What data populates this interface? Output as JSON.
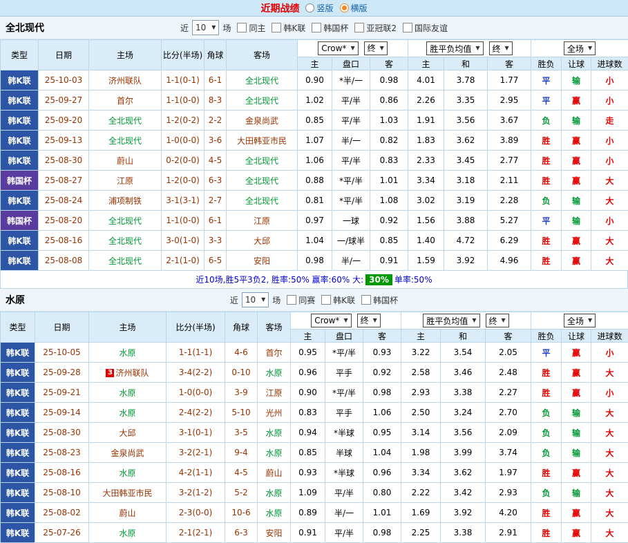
{
  "page": {
    "title": "近期战绩",
    "layout_options": [
      {
        "label": "竖版",
        "selected": false
      },
      {
        "label": "横版",
        "selected": true
      }
    ]
  },
  "colors": {
    "title_red": "#e60000",
    "team_regular": "#993300",
    "team_focus": "#009933",
    "summary_text": "#0000d0",
    "summary_highlight_bg": "#009900",
    "header_bg": "#d9ecf8",
    "topbar_bg": "#cde9f8"
  },
  "type_colors": {
    "韩K联": "#2c55a5",
    "韩国杯": "#5a3b9e"
  },
  "result_colors": {
    "胜": "#e60000",
    "平": "#1e3cc8",
    "负": "#009933",
    "赢": "#e60000",
    "输": "#009933",
    "走": "#e60000",
    "大": "#e60000",
    "小": "#e60000"
  },
  "sections": [
    {
      "team": "全北现代",
      "filter": {
        "prefix": "近",
        "count": "10",
        "suffix": "场",
        "checkboxes": [
          "同主",
          "韩K联",
          "韩国杯",
          "亚冠联2",
          "国际友谊"
        ]
      },
      "header": {
        "type": "类型",
        "date": "日期",
        "home": "主场",
        "score": "比分(半场)",
        "corner": "角球",
        "away": "客场",
        "selects": [
          "Crow*",
          "终",
          "胜平负均值",
          "终",
          "全场"
        ],
        "sub": [
          "主",
          "盘口",
          "客",
          "主",
          "和",
          "客",
          "胜负",
          "让球",
          "进球数"
        ]
      },
      "rows": [
        {
          "type": "韩K联",
          "date": "25-10-03",
          "home": "济州联队",
          "home_focus": false,
          "score": "1-1(0-1)",
          "corner": "6-1",
          "away": "全北现代",
          "away_focus": true,
          "h1": "0.90",
          "handicap": "*半/一",
          "a1": "0.98",
          "h2": "4.01",
          "d2": "3.78",
          "a2": "1.77",
          "result": "平",
          "bet_result": "输",
          "goals": "小"
        },
        {
          "type": "韩K联",
          "date": "25-09-27",
          "home": "首尔",
          "home_focus": false,
          "score": "1-1(0-0)",
          "corner": "8-3",
          "away": "全北现代",
          "away_focus": true,
          "h1": "1.02",
          "handicap": "平/半",
          "a1": "0.86",
          "h2": "2.26",
          "d2": "3.35",
          "a2": "2.95",
          "result": "平",
          "bet_result": "赢",
          "goals": "小"
        },
        {
          "type": "韩K联",
          "date": "25-09-20",
          "home": "全北现代",
          "home_focus": true,
          "score": "1-2(0-2)",
          "corner": "2-2",
          "away": "金泉尚武",
          "away_focus": false,
          "h1": "0.85",
          "handicap": "平/半",
          "a1": "1.03",
          "h2": "1.91",
          "d2": "3.56",
          "a2": "3.67",
          "result": "负",
          "bet_result": "输",
          "goals": "走"
        },
        {
          "type": "韩K联",
          "date": "25-09-13",
          "home": "全北现代",
          "home_focus": true,
          "score": "1-0(0-0)",
          "corner": "3-6",
          "away": "大田韩亚市民",
          "away_focus": false,
          "h1": "1.07",
          "handicap": "半/一",
          "a1": "0.82",
          "h2": "1.83",
          "d2": "3.62",
          "a2": "3.89",
          "result": "胜",
          "bet_result": "赢",
          "goals": "小"
        },
        {
          "type": "韩K联",
          "date": "25-08-30",
          "home": "蔚山",
          "home_focus": false,
          "score": "0-2(0-0)",
          "corner": "4-5",
          "away": "全北现代",
          "away_focus": true,
          "h1": "1.06",
          "handicap": "平/半",
          "a1": "0.83",
          "h2": "2.33",
          "d2": "3.45",
          "a2": "2.77",
          "result": "胜",
          "bet_result": "赢",
          "goals": "小"
        },
        {
          "type": "韩国杯",
          "date": "25-08-27",
          "home": "江原",
          "home_focus": false,
          "score": "1-2(0-0)",
          "corner": "6-3",
          "away": "全北现代",
          "away_focus": true,
          "h1": "0.88",
          "handicap": "*平/半",
          "a1": "1.01",
          "h2": "3.34",
          "d2": "3.18",
          "a2": "2.11",
          "result": "胜",
          "bet_result": "赢",
          "goals": "大"
        },
        {
          "type": "韩K联",
          "date": "25-08-24",
          "home": "浦项制铁",
          "home_focus": false,
          "score": "3-1(3-1)",
          "corner": "2-7",
          "away": "全北现代",
          "away_focus": true,
          "h1": "0.81",
          "handicap": "*平/半",
          "a1": "1.08",
          "h2": "3.02",
          "d2": "3.19",
          "a2": "2.28",
          "result": "负",
          "bet_result": "输",
          "goals": "大"
        },
        {
          "type": "韩国杯",
          "date": "25-08-20",
          "home": "全北现代",
          "home_focus": true,
          "score": "1-1(0-0)",
          "corner": "6-1",
          "away": "江原",
          "away_focus": false,
          "h1": "0.97",
          "handicap": "一球",
          "a1": "0.92",
          "h2": "1.56",
          "d2": "3.88",
          "a2": "5.27",
          "result": "平",
          "bet_result": "输",
          "goals": "小"
        },
        {
          "type": "韩K联",
          "date": "25-08-16",
          "home": "全北现代",
          "home_focus": true,
          "score": "3-0(1-0)",
          "corner": "3-3",
          "away": "大邱",
          "away_focus": false,
          "h1": "1.04",
          "handicap": "一/球半",
          "a1": "0.85",
          "h2": "1.40",
          "d2": "4.72",
          "a2": "6.29",
          "result": "胜",
          "bet_result": "赢",
          "goals": "大"
        },
        {
          "type": "韩K联",
          "date": "25-08-08",
          "home": "全北现代",
          "home_focus": true,
          "score": "2-1(1-0)",
          "corner": "6-5",
          "away": "安阳",
          "away_focus": false,
          "h1": "0.98",
          "handicap": "半/一",
          "a1": "0.91",
          "h2": "1.59",
          "d2": "3.92",
          "a2": "4.96",
          "result": "胜",
          "bet_result": "赢",
          "goals": "大"
        }
      ],
      "summary": {
        "segments": [
          {
            "text": "近10场,胜5平3负2, 胜率:50% 赢率:60% 大:",
            "highlight": false
          },
          {
            "text": "30%",
            "highlight": true
          },
          {
            "text": " 单率:50%",
            "highlight": false
          }
        ]
      }
    },
    {
      "team": "水原",
      "filter": {
        "prefix": "近",
        "count": "10",
        "suffix": "场",
        "checkboxes": [
          "同赛",
          "韩K联",
          "韩国杯"
        ]
      },
      "header": {
        "type": "类型",
        "date": "日期",
        "home": "主场",
        "score": "比分(半场)",
        "corner": "角球",
        "away": "客场",
        "selects": [
          "Crow*",
          "终",
          "胜平负均值",
          "终",
          "全场"
        ],
        "sub": [
          "主",
          "盘口",
          "客",
          "主",
          "和",
          "客",
          "胜负",
          "让球",
          "进球数"
        ]
      },
      "rows": [
        {
          "type": "韩K联",
          "date": "25-10-05",
          "home": "水原",
          "home_focus": true,
          "score": "1-1(1-1)",
          "corner": "4-6",
          "away": "首尔",
          "away_focus": false,
          "h1": "0.95",
          "handicap": "*平/半",
          "a1": "0.93",
          "h2": "3.22",
          "d2": "3.54",
          "a2": "2.05",
          "result": "平",
          "bet_result": "赢",
          "goals": "小"
        },
        {
          "type": "韩K联",
          "date": "25-09-28",
          "home": "济州联队",
          "home_focus": false,
          "home_badge": "3",
          "score": "3-4(2-2)",
          "corner": "0-10",
          "away": "水原",
          "away_focus": true,
          "h1": "0.96",
          "handicap": "平手",
          "a1": "0.92",
          "h2": "2.58",
          "d2": "3.46",
          "a2": "2.48",
          "result": "胜",
          "bet_result": "赢",
          "goals": "大"
        },
        {
          "type": "韩K联",
          "date": "25-09-21",
          "home": "水原",
          "home_focus": true,
          "score": "1-0(0-0)",
          "corner": "3-9",
          "away": "江原",
          "away_focus": false,
          "h1": "0.90",
          "handicap": "*平/半",
          "a1": "0.98",
          "h2": "2.93",
          "d2": "3.38",
          "a2": "2.27",
          "result": "胜",
          "bet_result": "赢",
          "goals": "小"
        },
        {
          "type": "韩K联",
          "date": "25-09-14",
          "home": "水原",
          "home_focus": true,
          "score": "2-4(2-2)",
          "corner": "5-10",
          "away": "光州",
          "away_focus": false,
          "h1": "0.83",
          "handicap": "平手",
          "a1": "1.06",
          "h2": "2.50",
          "d2": "3.24",
          "a2": "2.70",
          "result": "负",
          "bet_result": "输",
          "goals": "大"
        },
        {
          "type": "韩K联",
          "date": "25-08-30",
          "home": "大邱",
          "home_focus": false,
          "score": "3-1(0-1)",
          "corner": "3-5",
          "away": "水原",
          "away_focus": true,
          "h1": "0.94",
          "handicap": "*半球",
          "a1": "0.95",
          "h2": "3.14",
          "d2": "3.56",
          "a2": "2.09",
          "result": "负",
          "bet_result": "输",
          "goals": "大"
        },
        {
          "type": "韩K联",
          "date": "25-08-23",
          "home": "金泉尚武",
          "home_focus": false,
          "score": "3-2(2-1)",
          "corner": "9-4",
          "away": "水原",
          "away_focus": true,
          "h1": "0.85",
          "handicap": "半球",
          "a1": "1.04",
          "h2": "1.98",
          "d2": "3.99",
          "a2": "3.74",
          "result": "负",
          "bet_result": "输",
          "goals": "大"
        },
        {
          "type": "韩K联",
          "date": "25-08-16",
          "home": "水原",
          "home_focus": true,
          "score": "4-2(1-1)",
          "corner": "4-5",
          "away": "蔚山",
          "away_focus": false,
          "h1": "0.93",
          "handicap": "*半球",
          "a1": "0.96",
          "h2": "3.34",
          "d2": "3.62",
          "a2": "1.97",
          "result": "胜",
          "bet_result": "赢",
          "goals": "大"
        },
        {
          "type": "韩K联",
          "date": "25-08-10",
          "home": "大田韩亚市民",
          "home_focus": false,
          "score": "3-2(1-2)",
          "corner": "5-2",
          "away": "水原",
          "away_focus": true,
          "h1": "1.09",
          "handicap": "平/半",
          "a1": "0.80",
          "h2": "2.22",
          "d2": "3.42",
          "a2": "2.93",
          "result": "负",
          "bet_result": "输",
          "goals": "大"
        },
        {
          "type": "韩K联",
          "date": "25-08-02",
          "home": "蔚山",
          "home_focus": false,
          "score": "2-3(0-0)",
          "corner": "10-6",
          "away": "水原",
          "away_focus": true,
          "h1": "0.89",
          "handicap": "半/一",
          "a1": "1.01",
          "h2": "1.69",
          "d2": "3.92",
          "a2": "4.20",
          "result": "胜",
          "bet_result": "赢",
          "goals": "大"
        },
        {
          "type": "韩K联",
          "date": "25-07-26",
          "home": "水原",
          "home_focus": true,
          "score": "2-1(2-1)",
          "corner": "6-3",
          "away": "安阳",
          "away_focus": false,
          "h1": "0.91",
          "handicap": "平/半",
          "a1": "0.98",
          "h2": "2.25",
          "d2": "3.38",
          "a2": "2.91",
          "result": "胜",
          "bet_result": "赢",
          "goals": "大"
        }
      ],
      "summary": null
    }
  ]
}
